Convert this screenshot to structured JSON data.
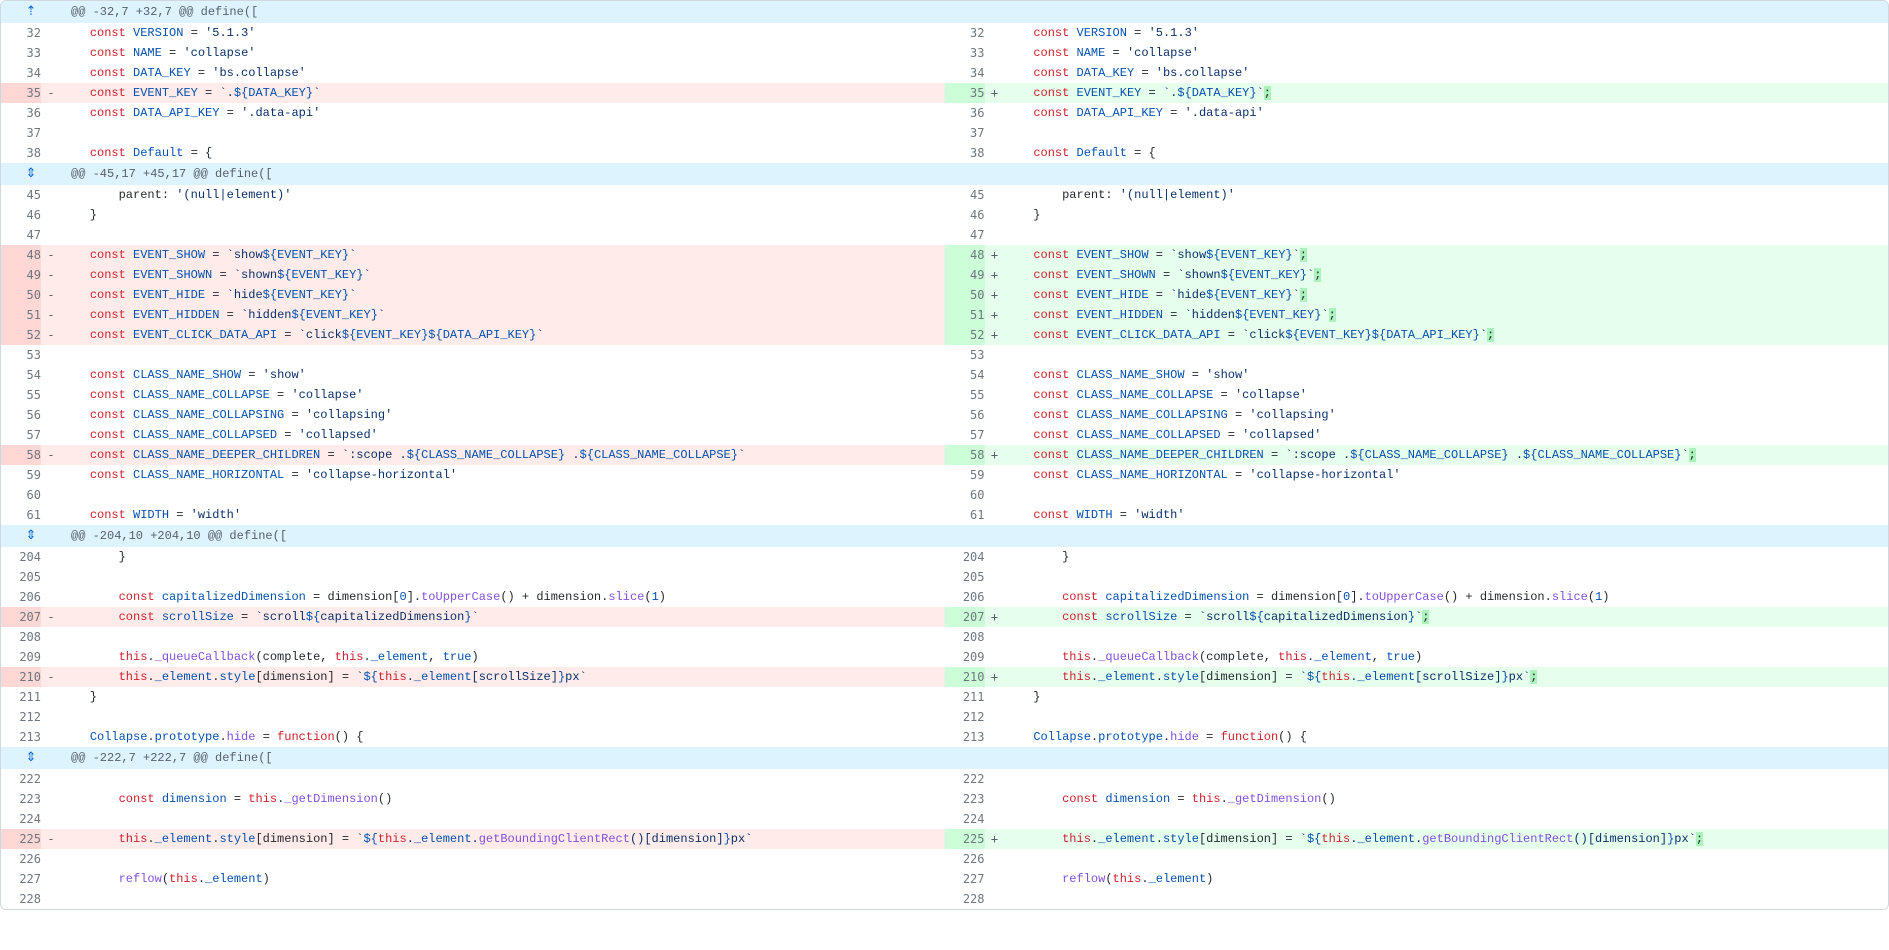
{
  "hunks": [
    {
      "header": "@@ -32,7 +32,7 @@ define([",
      "expand": "up",
      "rows": [
        {
          "l": "32",
          "r": "32",
          "t": "ctx",
          "code": "    <span class='tok-kw'>const</span> <span class='tok-const'>VERSION</span> = <span class='tok-str'>'5.1.3'</span>"
        },
        {
          "l": "33",
          "r": "33",
          "t": "ctx",
          "code": "    <span class='tok-kw'>const</span> <span class='tok-const'>NAME</span> = <span class='tok-str'>'collapse'</span>"
        },
        {
          "l": "34",
          "r": "34",
          "t": "ctx",
          "code": "    <span class='tok-kw'>const</span> <span class='tok-const'>DATA_KEY</span> = <span class='tok-str'>'bs.collapse'</span>"
        },
        {
          "l": "35",
          "r": "",
          "t": "del",
          "code": "    <span class='tok-kw'>const</span> <span class='tok-const'>EVENT_KEY</span> = <span class='tok-str'>`.<span class='tok-tmpl'>${</span><span class='tok-const'>DATA_KEY</span><span class='tok-tmpl'>}</span>`</span>",
          "rl": "35",
          "rcode": "    <span class='tok-kw'>const</span> <span class='tok-const'>EVENT_KEY</span> = <span class='tok-str'>`.<span class='tok-tmpl'>${</span><span class='tok-const'>DATA_KEY</span><span class='tok-tmpl'>}</span>`</span><span class='tok-semi'>;</span>"
        },
        {
          "l": "36",
          "r": "36",
          "t": "ctx",
          "code": "    <span class='tok-kw'>const</span> <span class='tok-const'>DATA_API_KEY</span> = <span class='tok-str'>'.data-api'</span>"
        },
        {
          "l": "37",
          "r": "37",
          "t": "ctx",
          "code": ""
        },
        {
          "l": "38",
          "r": "38",
          "t": "ctx",
          "code": "    <span class='tok-kw'>const</span> <span class='tok-const'>Default</span> = {"
        }
      ]
    },
    {
      "header": "@@ -45,17 +45,17 @@ define([",
      "expand": "both",
      "rows": [
        {
          "l": "45",
          "r": "45",
          "t": "ctx",
          "code": "        parent: <span class='tok-str'>'(null|element)'</span>"
        },
        {
          "l": "46",
          "r": "46",
          "t": "ctx",
          "code": "    }"
        },
        {
          "l": "47",
          "r": "47",
          "t": "ctx",
          "code": ""
        },
        {
          "l": "48",
          "r": "",
          "t": "del",
          "code": "    <span class='tok-kw'>const</span> <span class='tok-const'>EVENT_SHOW</span> = <span class='tok-str'>`show<span class='tok-tmpl'>${</span><span class='tok-const'>EVENT_KEY</span><span class='tok-tmpl'>}</span>`</span>",
          "rl": "48",
          "rcode": "    <span class='tok-kw'>const</span> <span class='tok-const'>EVENT_SHOW</span> = <span class='tok-str'>`show<span class='tok-tmpl'>${</span><span class='tok-const'>EVENT_KEY</span><span class='tok-tmpl'>}</span>`</span><span class='tok-semi'>;</span>"
        },
        {
          "l": "49",
          "r": "",
          "t": "del",
          "code": "    <span class='tok-kw'>const</span> <span class='tok-const'>EVENT_SHOWN</span> = <span class='tok-str'>`shown<span class='tok-tmpl'>${</span><span class='tok-const'>EVENT_KEY</span><span class='tok-tmpl'>}</span>`</span>",
          "rl": "49",
          "rcode": "    <span class='tok-kw'>const</span> <span class='tok-const'>EVENT_SHOWN</span> = <span class='tok-str'>`shown<span class='tok-tmpl'>${</span><span class='tok-const'>EVENT_KEY</span><span class='tok-tmpl'>}</span>`</span><span class='tok-semi'>;</span>"
        },
        {
          "l": "50",
          "r": "",
          "t": "del",
          "code": "    <span class='tok-kw'>const</span> <span class='tok-const'>EVENT_HIDE</span> = <span class='tok-str'>`hide<span class='tok-tmpl'>${</span><span class='tok-const'>EVENT_KEY</span><span class='tok-tmpl'>}</span>`</span>",
          "rl": "50",
          "rcode": "    <span class='tok-kw'>const</span> <span class='tok-const'>EVENT_HIDE</span> = <span class='tok-str'>`hide<span class='tok-tmpl'>${</span><span class='tok-const'>EVENT_KEY</span><span class='tok-tmpl'>}</span>`</span><span class='tok-semi'>;</span>"
        },
        {
          "l": "51",
          "r": "",
          "t": "del",
          "code": "    <span class='tok-kw'>const</span> <span class='tok-const'>EVENT_HIDDEN</span> = <span class='tok-str'>`hidden<span class='tok-tmpl'>${</span><span class='tok-const'>EVENT_KEY</span><span class='tok-tmpl'>}</span>`</span>",
          "rl": "51",
          "rcode": "    <span class='tok-kw'>const</span> <span class='tok-const'>EVENT_HIDDEN</span> = <span class='tok-str'>`hidden<span class='tok-tmpl'>${</span><span class='tok-const'>EVENT_KEY</span><span class='tok-tmpl'>}</span>`</span><span class='tok-semi'>;</span>"
        },
        {
          "l": "52",
          "r": "",
          "t": "del",
          "code": "    <span class='tok-kw'>const</span> <span class='tok-const'>EVENT_CLICK_DATA_API</span> = <span class='tok-str'>`click<span class='tok-tmpl'>${</span><span class='tok-const'>EVENT_KEY</span><span class='tok-tmpl'>}${</span><span class='tok-const'>DATA_API_KEY</span><span class='tok-tmpl'>}</span>`</span>",
          "rl": "52",
          "rcode": "    <span class='tok-kw'>const</span> <span class='tok-const'>EVENT_CLICK_DATA_API</span> = <span class='tok-str'>`click<span class='tok-tmpl'>${</span><span class='tok-const'>EVENT_KEY</span><span class='tok-tmpl'>}${</span><span class='tok-const'>DATA_API_KEY</span><span class='tok-tmpl'>}</span>`</span><span class='tok-semi'>;</span>"
        },
        {
          "l": "53",
          "r": "53",
          "t": "ctx",
          "code": ""
        },
        {
          "l": "54",
          "r": "54",
          "t": "ctx",
          "code": "    <span class='tok-kw'>const</span> <span class='tok-const'>CLASS_NAME_SHOW</span> = <span class='tok-str'>'show'</span>"
        },
        {
          "l": "55",
          "r": "55",
          "t": "ctx",
          "code": "    <span class='tok-kw'>const</span> <span class='tok-const'>CLASS_NAME_COLLAPSE</span> = <span class='tok-str'>'collapse'</span>"
        },
        {
          "l": "56",
          "r": "56",
          "t": "ctx",
          "code": "    <span class='tok-kw'>const</span> <span class='tok-const'>CLASS_NAME_COLLAPSING</span> = <span class='tok-str'>'collapsing'</span>"
        },
        {
          "l": "57",
          "r": "57",
          "t": "ctx",
          "code": "    <span class='tok-kw'>const</span> <span class='tok-const'>CLASS_NAME_COLLAPSED</span> = <span class='tok-str'>'collapsed'</span>"
        },
        {
          "l": "58",
          "r": "",
          "t": "del",
          "code": "    <span class='tok-kw'>const</span> <span class='tok-const'>CLASS_NAME_DEEPER_CHILDREN</span> = <span class='tok-str'>`:scope .<span class='tok-tmpl'>${</span><span class='tok-const'>CLASS_NAME_COLLAPSE</span><span class='tok-tmpl'>}</span> .<span class='tok-tmpl'>${</span><span class='tok-const'>CLASS_NAME_COLLAPSE</span><span class='tok-tmpl'>}</span>`</span>",
          "rl": "58",
          "rcode": "    <span class='tok-kw'>const</span> <span class='tok-const'>CLASS_NAME_DEEPER_CHILDREN</span> = <span class='tok-str'>`:scope .<span class='tok-tmpl'>${</span><span class='tok-const'>CLASS_NAME_COLLAPSE</span><span class='tok-tmpl'>}</span> .<span class='tok-tmpl'>${</span><span class='tok-const'>CLASS_NAME_COLLAPSE</span><span class='tok-tmpl'>}</span>`</span><span class='tok-semi'>;</span>"
        },
        {
          "l": "59",
          "r": "59",
          "t": "ctx",
          "code": "    <span class='tok-kw'>const</span> <span class='tok-const'>CLASS_NAME_HORIZONTAL</span> = <span class='tok-str'>'collapse-horizontal'</span>"
        },
        {
          "l": "60",
          "r": "60",
          "t": "ctx",
          "code": ""
        },
        {
          "l": "61",
          "r": "61",
          "t": "ctx",
          "code": "    <span class='tok-kw'>const</span> <span class='tok-const'>WIDTH</span> = <span class='tok-str'>'width'</span>"
        }
      ]
    },
    {
      "header": "@@ -204,10 +204,10 @@ define([",
      "expand": "both",
      "rows": [
        {
          "l": "204",
          "r": "204",
          "t": "ctx",
          "code": "        }"
        },
        {
          "l": "205",
          "r": "205",
          "t": "ctx",
          "code": ""
        },
        {
          "l": "206",
          "r": "206",
          "t": "ctx",
          "code": "        <span class='tok-kw'>const</span> <span class='tok-const'>capitalizedDimension</span> = dimension[<span class='tok-num'>0</span>].<span class='tok-fn'>toUpperCase</span>() + dimension.<span class='tok-fn'>slice</span>(<span class='tok-num'>1</span>)"
        },
        {
          "l": "207",
          "r": "",
          "t": "del",
          "code": "        <span class='tok-kw'>const</span> <span class='tok-const'>scrollSize</span> = <span class='tok-str'>`scroll<span class='tok-tmpl'>${</span>capitalizedDimension<span class='tok-tmpl'>}</span>`</span>",
          "rl": "207",
          "rcode": "        <span class='tok-kw'>const</span> <span class='tok-const'>scrollSize</span> = <span class='tok-str'>`scroll<span class='tok-tmpl'>${</span>capitalizedDimension<span class='tok-tmpl'>}</span>`</span><span class='tok-semi'>;</span>"
        },
        {
          "l": "208",
          "r": "208",
          "t": "ctx",
          "code": ""
        },
        {
          "l": "209",
          "r": "209",
          "t": "ctx",
          "code": "        <span class='tok-kw'>this</span>.<span class='tok-fn'>_queueCallback</span>(complete, <span class='tok-kw'>this</span>.<span class='tok-prop'>_element</span>, <span class='tok-num'>true</span>)"
        },
        {
          "l": "210",
          "r": "",
          "t": "del",
          "code": "        <span class='tok-kw'>this</span>.<span class='tok-prop'>_element</span>.<span class='tok-prop'>style</span>[dimension] = <span class='tok-str'>`<span class='tok-tmpl'>${</span><span class='tok-kw'>this</span>.<span class='tok-prop'>_element</span>[scrollSize]<span class='tok-tmpl'>}</span>px`</span>",
          "rl": "210",
          "rcode": "        <span class='tok-kw'>this</span>.<span class='tok-prop'>_element</span>.<span class='tok-prop'>style</span>[dimension] = <span class='tok-str'>`<span class='tok-tmpl'>${</span><span class='tok-kw'>this</span>.<span class='tok-prop'>_element</span>[scrollSize]<span class='tok-tmpl'>}</span>px`</span><span class='tok-semi'>;</span>"
        },
        {
          "l": "211",
          "r": "211",
          "t": "ctx",
          "code": "    }"
        },
        {
          "l": "212",
          "r": "212",
          "t": "ctx",
          "code": ""
        },
        {
          "l": "213",
          "r": "213",
          "t": "ctx",
          "code": "    <span class='tok-const'>Collapse</span>.<span class='tok-prop'>prototype</span>.<span class='tok-fn'>hide</span> = <span class='tok-kw'>function</span>() {"
        }
      ]
    },
    {
      "header": "@@ -222,7 +222,7 @@ define([",
      "expand": "both",
      "rows": [
        {
          "l": "222",
          "r": "222",
          "t": "ctx",
          "code": ""
        },
        {
          "l": "223",
          "r": "223",
          "t": "ctx",
          "code": "        <span class='tok-kw'>const</span> <span class='tok-const'>dimension</span> = <span class='tok-kw'>this</span>.<span class='tok-fn'>_getDimension</span>()"
        },
        {
          "l": "224",
          "r": "224",
          "t": "ctx",
          "code": ""
        },
        {
          "l": "225",
          "r": "",
          "t": "del",
          "code": "        <span class='tok-kw'>this</span>.<span class='tok-prop'>_element</span>.<span class='tok-prop'>style</span>[dimension] = <span class='tok-str'>`<span class='tok-tmpl'>${</span><span class='tok-kw'>this</span>.<span class='tok-prop'>_element</span>.<span class='tok-fn'>getBoundingClientRect</span>()[dimension]<span class='tok-tmpl'>}</span>px`</span>",
          "rl": "225",
          "rcode": "        <span class='tok-kw'>this</span>.<span class='tok-prop'>_element</span>.<span class='tok-prop'>style</span>[dimension] = <span class='tok-str'>`<span class='tok-tmpl'>${</span><span class='tok-kw'>this</span>.<span class='tok-prop'>_element</span>.<span class='tok-fn'>getBoundingClientRect</span>()[dimension]<span class='tok-tmpl'>}</span>px`</span><span class='tok-semi'>;</span>"
        },
        {
          "l": "226",
          "r": "226",
          "t": "ctx",
          "code": ""
        },
        {
          "l": "227",
          "r": "227",
          "t": "ctx",
          "code": "        <span class='tok-fn'>reflow</span>(<span class='tok-kw'>this</span>.<span class='tok-prop'>_element</span>)"
        },
        {
          "l": "228",
          "r": "228",
          "t": "ctx",
          "code": ""
        }
      ]
    }
  ]
}
